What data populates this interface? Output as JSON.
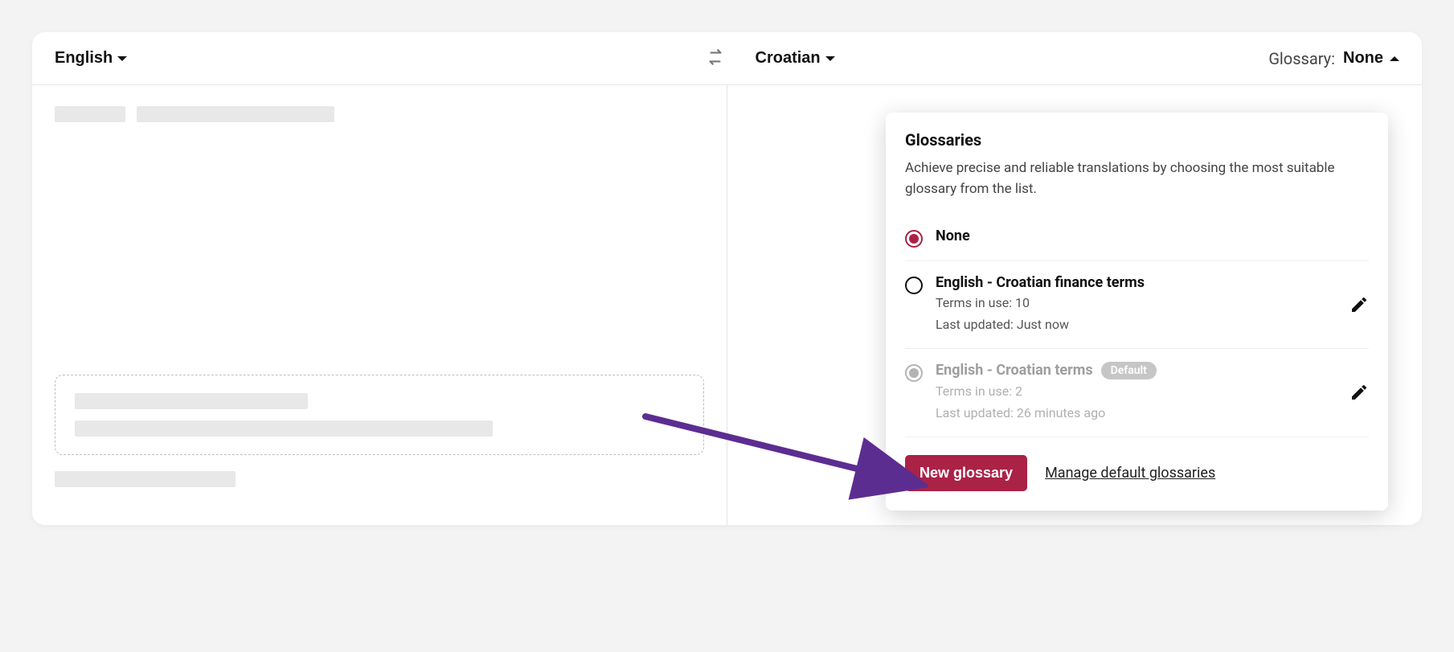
{
  "header": {
    "source_language": "English",
    "target_language": "Croatian",
    "glossary_label": "Glossary:",
    "glossary_value": "None"
  },
  "dropdown": {
    "title": "Glossaries",
    "description": "Achieve precise and reliable translations by choosing the most suitable glossary from the list.",
    "options": [
      {
        "name": "None",
        "selected": true
      },
      {
        "name": "English - Croatian finance terms",
        "terms_label": "Terms in use: 10",
        "updated_label": "Last updated: Just now",
        "selected": false
      },
      {
        "name": "English - Croatian terms",
        "default_badge": "Default",
        "terms_label": "Terms in use: 2",
        "updated_label": "Last updated: 26 minutes ago",
        "disabled": true
      }
    ],
    "new_glossary_label": "New glossary",
    "manage_link_label": "Manage default glossaries"
  }
}
